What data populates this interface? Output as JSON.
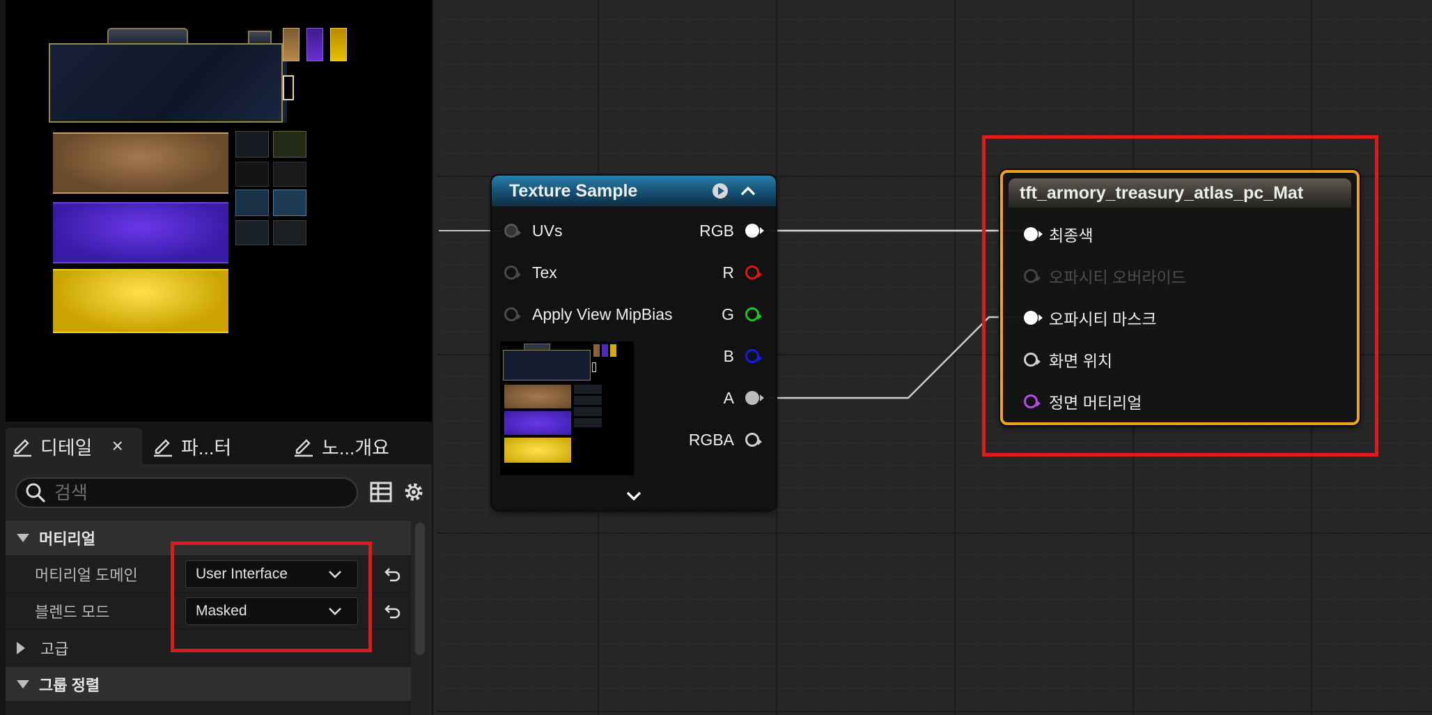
{
  "details_panel": {
    "tabs": [
      {
        "label": "디테일",
        "close": "×"
      },
      {
        "label": "파...터"
      },
      {
        "label": "노...개요"
      }
    ],
    "search": {
      "placeholder": "검색"
    },
    "sections": {
      "material": {
        "label": "머티리얼"
      },
      "advanced": {
        "label": "고급"
      },
      "group_sort": {
        "label": "그룹 정렬"
      }
    },
    "properties": [
      {
        "label": "머티리얼 도메인",
        "value": "User Interface"
      },
      {
        "label": "블렌드 모드",
        "value": "Masked"
      }
    ]
  },
  "texture_sample_node": {
    "title": "Texture Sample",
    "inputs": [
      {
        "label": "UVs",
        "connected": true
      },
      {
        "label": "Tex",
        "connected": false
      },
      {
        "label": "Apply View MipBias",
        "connected": false
      }
    ],
    "outputs": [
      {
        "label": "RGB",
        "color": "#ffffff",
        "connected": true
      },
      {
        "label": "R",
        "color": "#e01818"
      },
      {
        "label": "G",
        "color": "#1ec41e"
      },
      {
        "label": "B",
        "color": "#1a1ae8"
      },
      {
        "label": "A",
        "color": "#bcbcbc",
        "connected": true
      },
      {
        "label": "RGBA",
        "color": "#d0d0d0"
      }
    ]
  },
  "material_node": {
    "title": "tft_armory_treasury_atlas_pc_Mat",
    "inputs": [
      {
        "label": "최종색",
        "color": "#ffffff",
        "enabled": true,
        "connected": true
      },
      {
        "label": "오파시티 오버라이드",
        "color": "#4a4a4a",
        "enabled": false
      },
      {
        "label": "오파시티 마스크",
        "color": "#ffffff",
        "enabled": true,
        "connected": true
      },
      {
        "label": "화면 위치",
        "color": "#d0d0d0",
        "enabled": true
      },
      {
        "label": "정면 머티리얼",
        "color": "#b44ee0",
        "enabled": true
      }
    ]
  },
  "colors": {
    "highlight": "#e0191b",
    "texture_header": "#1f6a95",
    "material_border": "#f0a21a"
  }
}
